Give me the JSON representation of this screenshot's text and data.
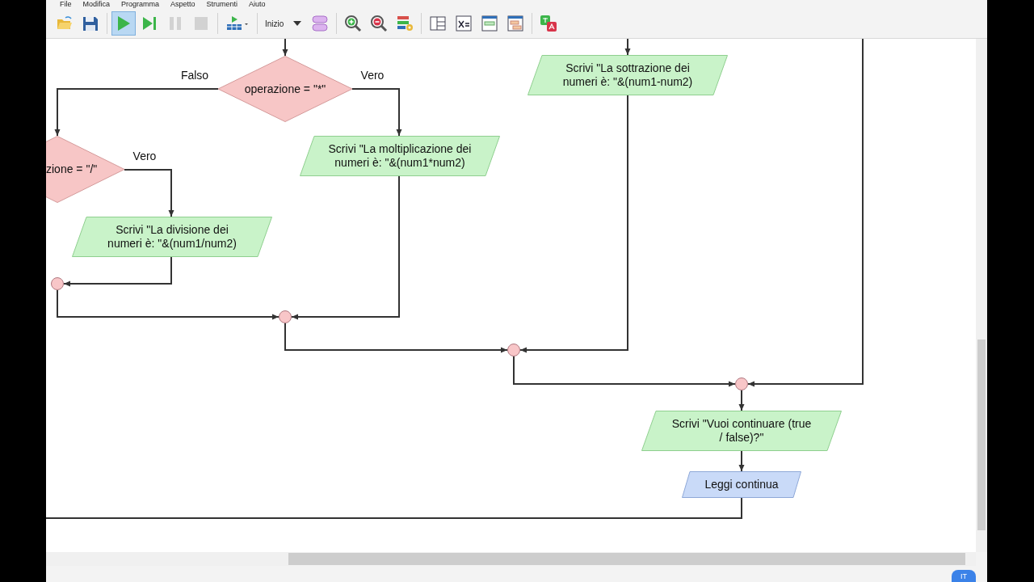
{
  "menu": [
    {
      "label": "File"
    },
    {
      "label": "Modifica"
    },
    {
      "label": "Programma"
    },
    {
      "label": "Aspetto"
    },
    {
      "label": "Strumenti"
    },
    {
      "label": "Aiuto"
    }
  ],
  "toolbar": [
    {
      "kind": "open",
      "selected": false,
      "disabled": false
    },
    {
      "kind": "save",
      "selected": false,
      "disabled": false
    },
    {
      "kind": "sep"
    },
    {
      "kind": "run",
      "selected": true,
      "disabled": false
    },
    {
      "kind": "step",
      "selected": false,
      "disabled": false
    },
    {
      "kind": "pause",
      "selected": false,
      "disabled": true
    },
    {
      "kind": "stop",
      "selected": false,
      "disabled": true
    },
    {
      "kind": "sep"
    },
    {
      "kind": "runmenu",
      "selected": false,
      "disabled": false
    },
    {
      "kind": "sep"
    },
    {
      "kind": "dropdown",
      "value": "Inizio"
    },
    {
      "kind": "shapes",
      "selected": false,
      "disabled": false
    },
    {
      "kind": "sep"
    },
    {
      "kind": "zoomin",
      "selected": false,
      "disabled": false
    },
    {
      "kind": "zoomout",
      "selected": false,
      "disabled": false
    },
    {
      "kind": "style",
      "selected": false,
      "disabled": false
    },
    {
      "kind": "sep"
    },
    {
      "kind": "panels",
      "selected": false,
      "disabled": false
    },
    {
      "kind": "variables",
      "selected": false,
      "disabled": false
    },
    {
      "kind": "console",
      "selected": false,
      "disabled": false
    },
    {
      "kind": "code",
      "selected": false,
      "disabled": false
    },
    {
      "kind": "sep"
    },
    {
      "kind": "translate",
      "selected": false,
      "disabled": false
    }
  ],
  "flowchart": {
    "nodes": [
      {
        "kind": "decision",
        "text": "operazione = \"*\""
      },
      {
        "kind": "decision",
        "text": "zione = \"/\""
      },
      {
        "kind": "output",
        "text": "Scrivi \"La moltiplicazione dei numeri è: \"&(num1*num2)"
      },
      {
        "kind": "output",
        "text": "Scrivi \"La divisione dei numeri è: \"&(num1/num2)"
      },
      {
        "kind": "output",
        "text": "Scrivi \"La sottrazione dei numeri è: \"&(num1-num2)"
      },
      {
        "kind": "output",
        "text": "Scrivi \"Vuoi continuare (true / false)?\""
      },
      {
        "kind": "input",
        "text": "Leggi continua"
      },
      {
        "kind": "junction"
      },
      {
        "kind": "junction"
      },
      {
        "kind": "junction"
      },
      {
        "kind": "junction"
      }
    ],
    "labels": [
      "Falso",
      "Vero",
      "Vero"
    ]
  },
  "status_bar": {
    "language": "IT"
  }
}
